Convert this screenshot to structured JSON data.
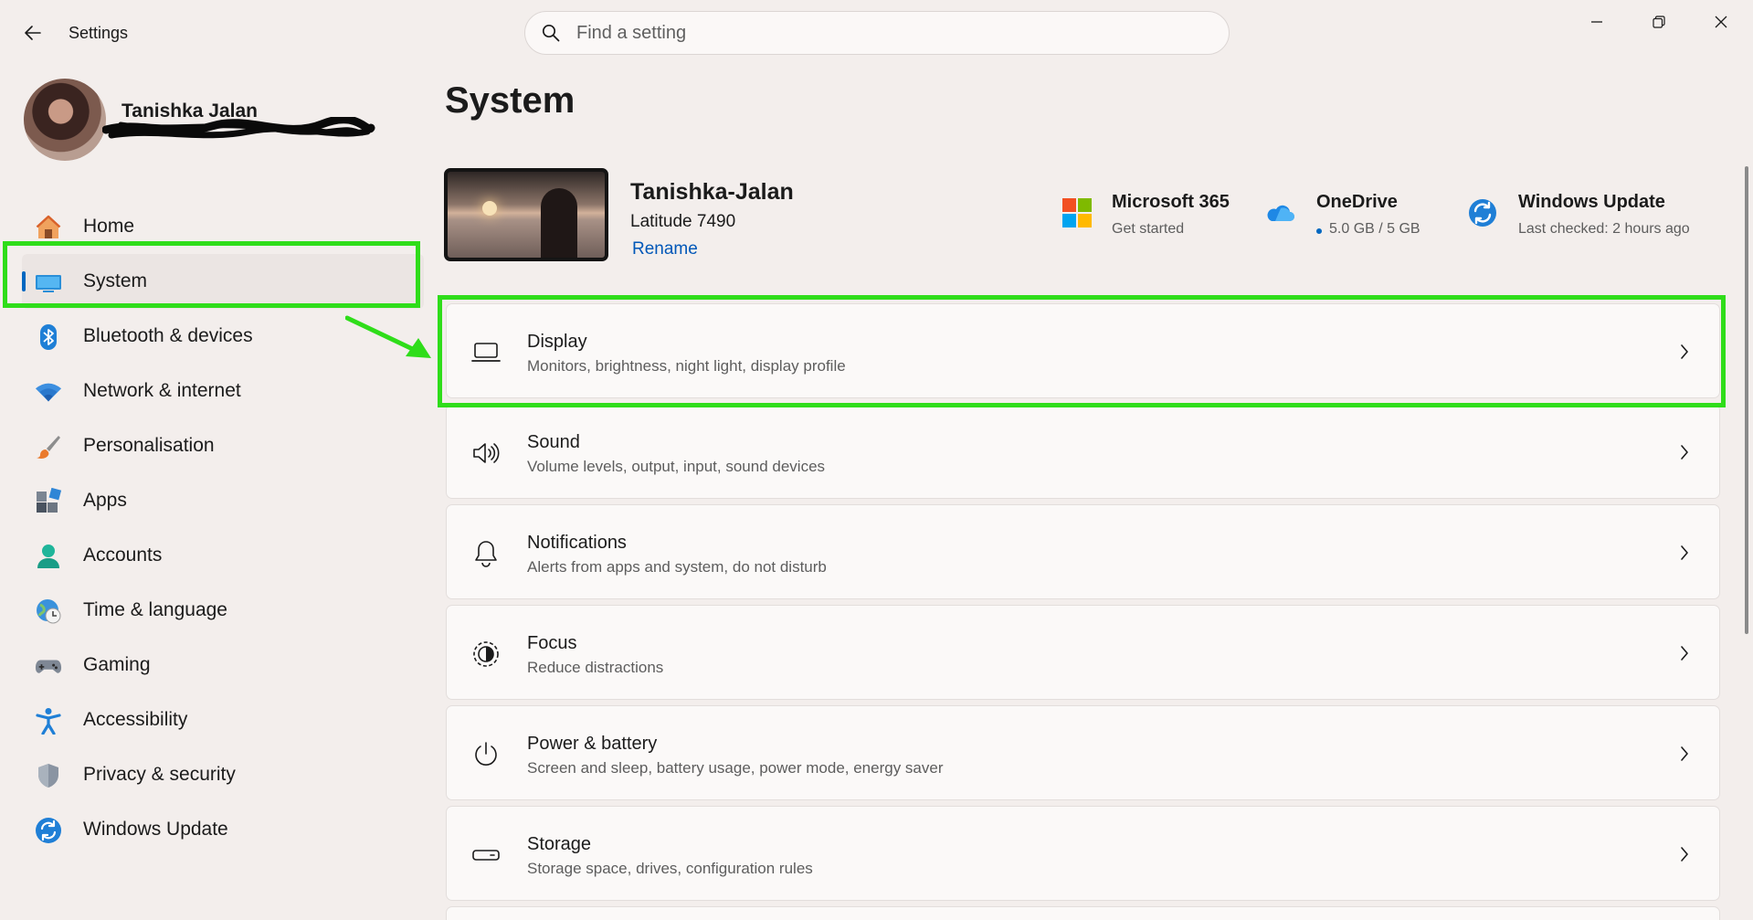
{
  "window": {
    "title": "Settings",
    "search_placeholder": "Find a setting"
  },
  "profile": {
    "name": "Tanishka Jalan"
  },
  "sidebar": {
    "items": [
      {
        "label": "Home",
        "icon": "home-icon"
      },
      {
        "label": "System",
        "icon": "system-icon",
        "selected": true
      },
      {
        "label": "Bluetooth & devices",
        "icon": "bluetooth-icon"
      },
      {
        "label": "Network & internet",
        "icon": "wifi-icon"
      },
      {
        "label": "Personalisation",
        "icon": "brush-icon"
      },
      {
        "label": "Apps",
        "icon": "apps-icon"
      },
      {
        "label": "Accounts",
        "icon": "accounts-icon"
      },
      {
        "label": "Time & language",
        "icon": "globe-clock-icon"
      },
      {
        "label": "Gaming",
        "icon": "gamepad-icon"
      },
      {
        "label": "Accessibility",
        "icon": "accessibility-icon"
      },
      {
        "label": "Privacy & security",
        "icon": "shield-icon"
      },
      {
        "label": "Windows Update",
        "icon": "update-icon"
      }
    ]
  },
  "main": {
    "title": "System",
    "device": {
      "name": "Tanishka-Jalan",
      "model": "Latitude 7490",
      "rename_label": "Rename"
    },
    "quick_links": [
      {
        "title": "Microsoft 365",
        "subtitle": "Get started",
        "icon": "microsoft-logo-icon"
      },
      {
        "title": "OneDrive",
        "subtitle": "5.0 GB / 5 GB",
        "icon": "onedrive-cloud-icon"
      },
      {
        "title": "Windows Update",
        "subtitle": "Last checked: 2 hours ago",
        "icon": "update-icon"
      }
    ],
    "cards": [
      {
        "title": "Display",
        "subtitle": "Monitors, brightness, night light, display profile",
        "icon": "laptop-icon"
      },
      {
        "title": "Sound",
        "subtitle": "Volume levels, output, input, sound devices",
        "icon": "speaker-icon"
      },
      {
        "title": "Notifications",
        "subtitle": "Alerts from apps and system, do not disturb",
        "icon": "bell-icon"
      },
      {
        "title": "Focus",
        "subtitle": "Reduce distractions",
        "icon": "focus-icon"
      },
      {
        "title": "Power & battery",
        "subtitle": "Screen and sleep, battery usage, power mode, energy saver",
        "icon": "power-icon"
      },
      {
        "title": "Storage",
        "subtitle": "Storage space, drives, configuration rules",
        "icon": "drive-icon"
      }
    ]
  },
  "colors": {
    "accent": "#0067c0",
    "highlight": "#2fdd1a",
    "background": "#f3eeec"
  }
}
